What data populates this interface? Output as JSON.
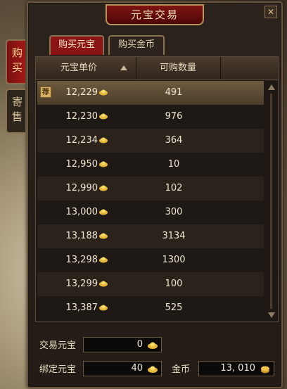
{
  "window": {
    "title": "元宝交易",
    "close_label": "✕"
  },
  "side_tabs": [
    {
      "label": "购买"
    },
    {
      "label": "寄售"
    }
  ],
  "sub_tabs": [
    {
      "label": "购买元宝"
    },
    {
      "label": "购买金币"
    }
  ],
  "table": {
    "headers": {
      "price": "元宝单价",
      "qty": "可购数量"
    },
    "recommend_label": "荐",
    "rows": [
      {
        "price": "12,229",
        "qty": "491"
      },
      {
        "price": "12,230",
        "qty": "976"
      },
      {
        "price": "12,234",
        "qty": "364"
      },
      {
        "price": "12,950",
        "qty": "10"
      },
      {
        "price": "12,990",
        "qty": "102"
      },
      {
        "price": "13,000",
        "qty": "300"
      },
      {
        "price": "13,188",
        "qty": "3134"
      },
      {
        "price": "13,298",
        "qty": "1300"
      },
      {
        "price": "13,299",
        "qty": "100"
      },
      {
        "price": "13,387",
        "qty": "525"
      }
    ]
  },
  "footer": {
    "trade_label": "交易元宝",
    "trade_value": "0",
    "bound_label": "绑定元宝",
    "bound_value": "40",
    "gold_label": "金币",
    "gold_value": "13, 010"
  },
  "colors": {
    "accent": "#8a1414",
    "gold": "#e8b83a",
    "text": "#efe6d2"
  }
}
